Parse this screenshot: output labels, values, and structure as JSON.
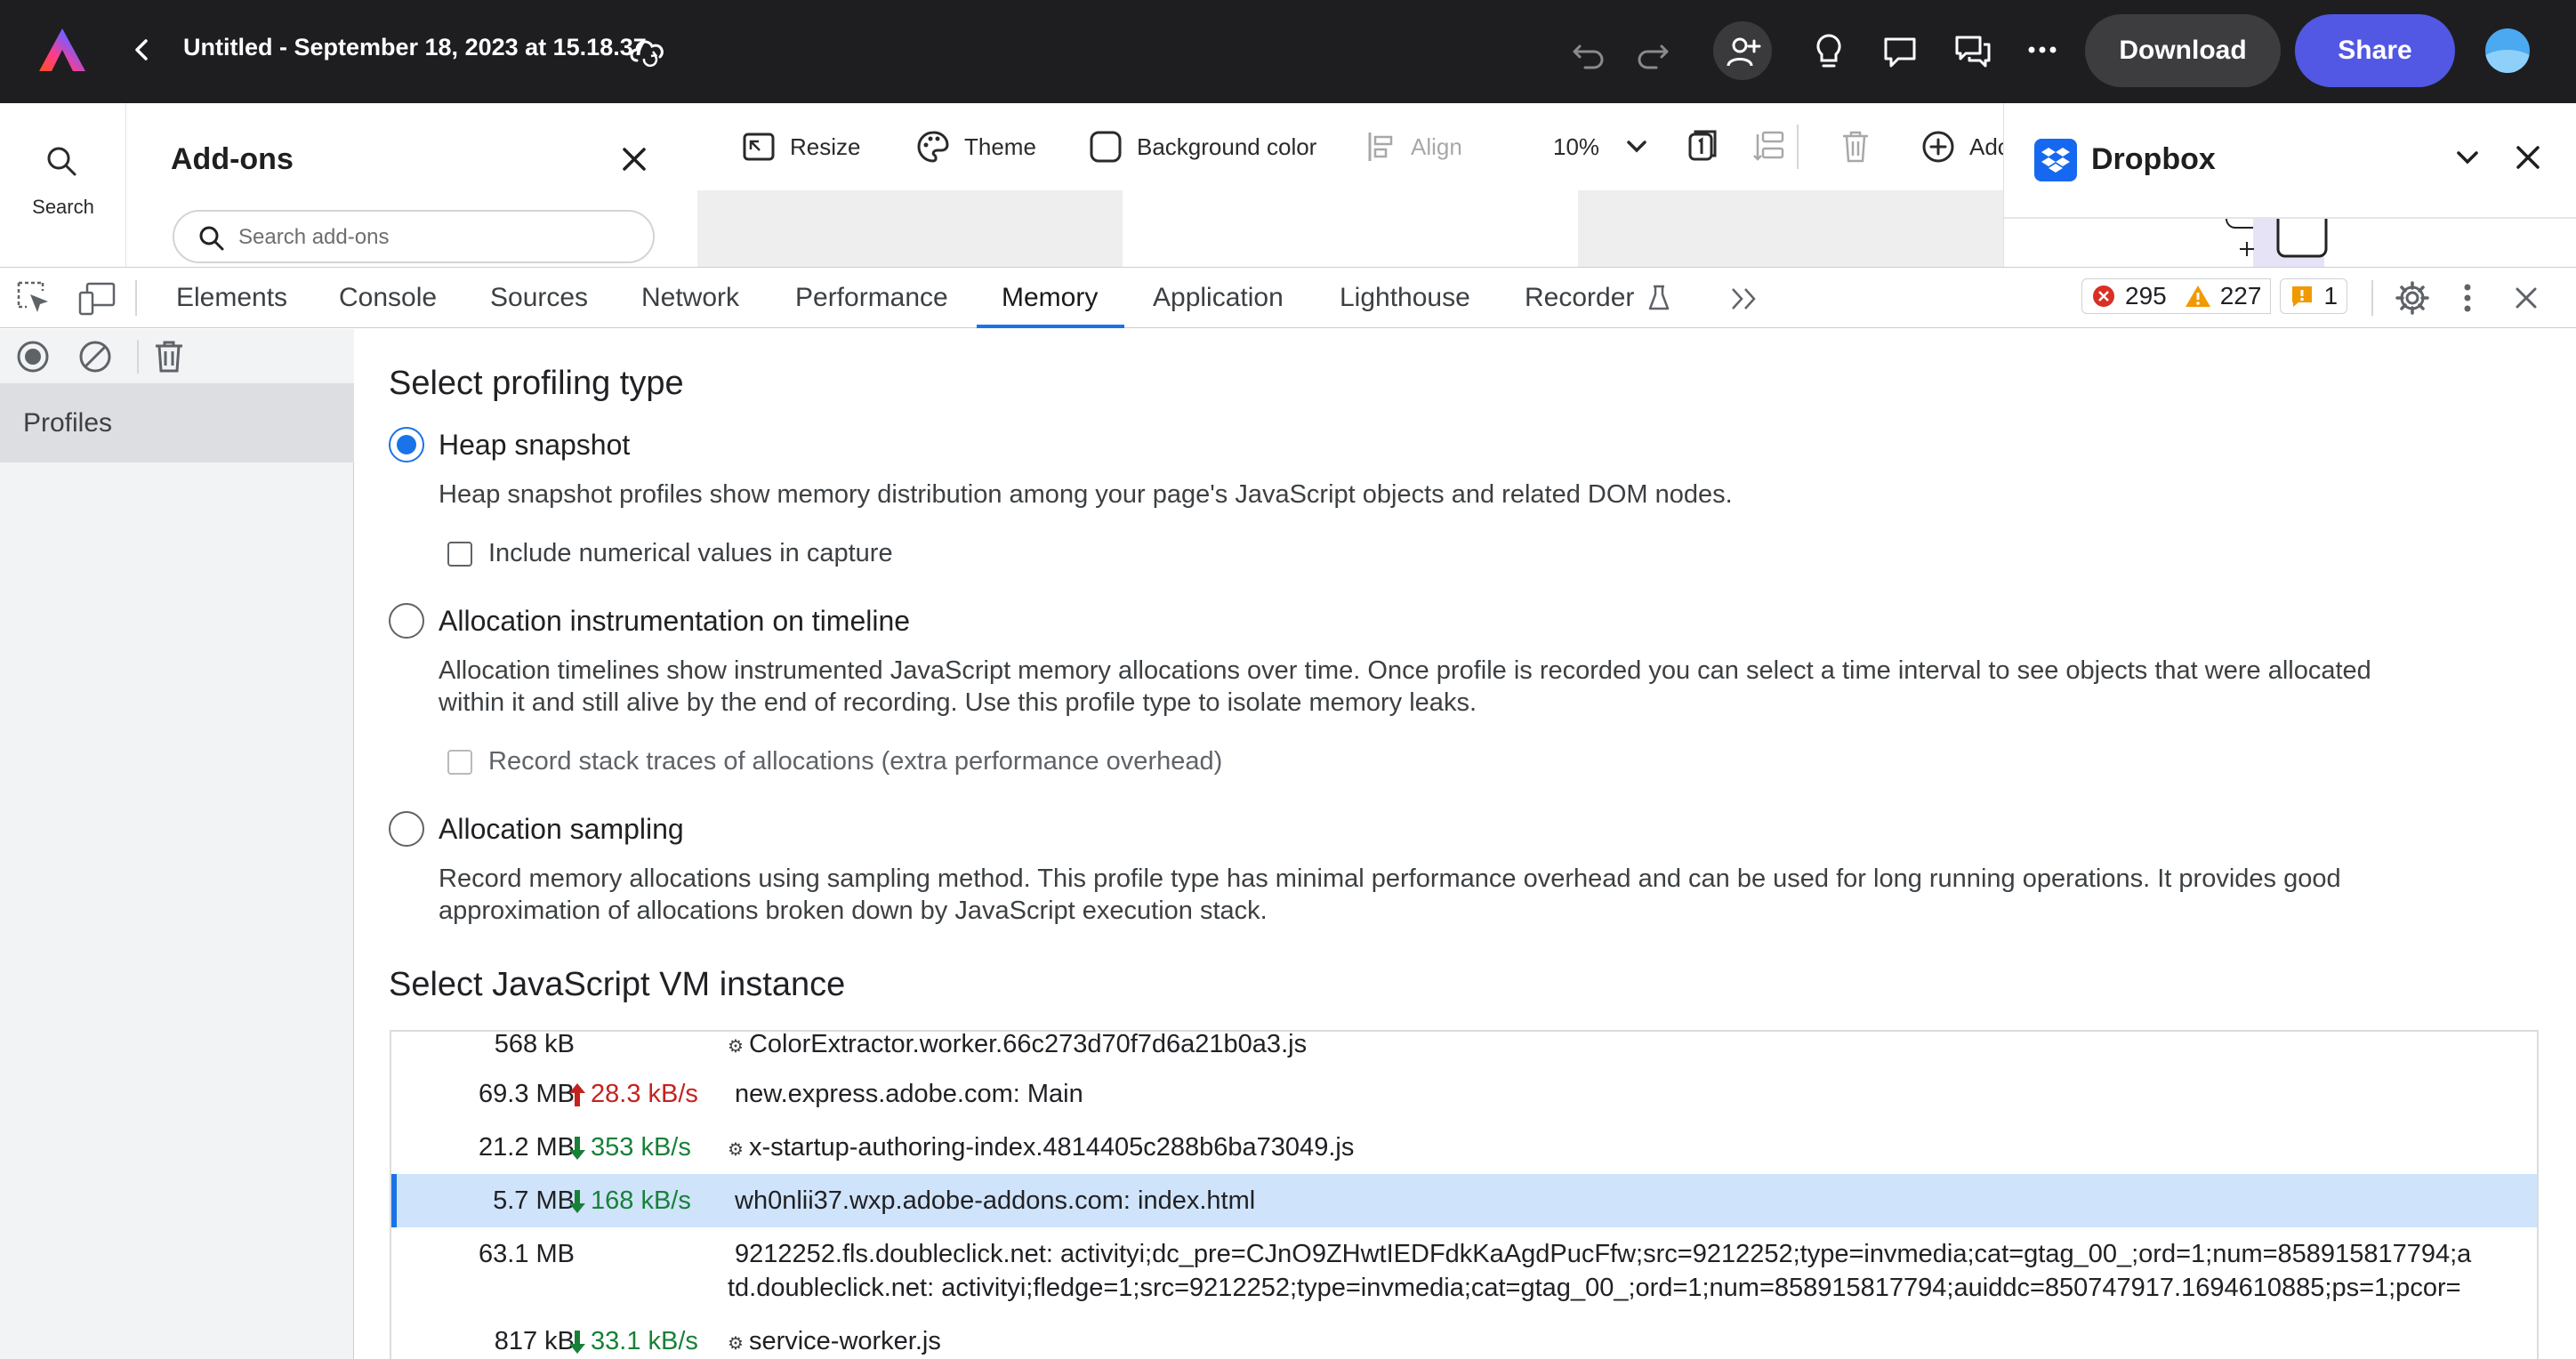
{
  "app": {
    "doc_title": "Untitled - September 18, 2023 at 15.18.37",
    "download_label": "Download",
    "share_label": "Share"
  },
  "rail": {
    "search_label": "Search"
  },
  "addons": {
    "title": "Add-ons",
    "search_placeholder": "Search add-ons"
  },
  "canvas_toolbar": {
    "resize": "Resize",
    "theme": "Theme",
    "background_color": "Background color",
    "align": "Align",
    "zoom": "10%",
    "add_partial": "Adc"
  },
  "dropbox": {
    "title": "Dropbox"
  },
  "devtools": {
    "tabs": [
      "Elements",
      "Console",
      "Sources",
      "Network",
      "Performance",
      "Memory",
      "Application",
      "Lighthouse",
      "Recorder"
    ],
    "active_tab": "Memory",
    "errors": "295",
    "warnings": "227",
    "issues": "1",
    "sidebar": {
      "profiles_label": "Profiles"
    },
    "profiling": {
      "heading": "Select profiling type",
      "heap_snapshot": {
        "label": "Heap snapshot",
        "description": "Heap snapshot profiles show memory distribution among your page's JavaScript objects and related DOM nodes.",
        "option": "Include numerical values in capture"
      },
      "allocation_timeline": {
        "label": "Allocation instrumentation on timeline",
        "description_1": "Allocation timelines show instrumented JavaScript memory allocations over time. Once profile is recorded you can select a time interval to see objects that were allocated",
        "description_2": "within it and still alive by the end of recording. Use this profile type to isolate memory leaks.",
        "option": "Record stack traces of allocations (extra performance overhead)"
      },
      "allocation_sampling": {
        "label": "Allocation sampling",
        "description_1": "Record memory allocations using sampling method. This profile type has minimal performance overhead and can be used for long running operations. It provides good",
        "description_2": "approximation of allocations broken down by JavaScript execution stack."
      }
    },
    "vm": {
      "heading": "Select JavaScript VM instance",
      "rows": [
        {
          "size": "568 kB",
          "rate": "",
          "dir": "",
          "name": "ColorExtractor.worker.66c273d70f7d6a21b0a3.js",
          "worker": true
        },
        {
          "size": "69.3 MB",
          "rate": "28.3 kB/s",
          "dir": "up",
          "name": "new.express.adobe.com: Main",
          "worker": false
        },
        {
          "size": "21.2 MB",
          "rate": "353 kB/s",
          "dir": "down",
          "name": "x-startup-authoring-index.4814405c288b6ba73049.js",
          "worker": true
        },
        {
          "size": "5.7 MB",
          "rate": "168 kB/s",
          "dir": "down",
          "name": "wh0nlii37.wxp.adobe-addons.com: index.html",
          "worker": false,
          "selected": true
        },
        {
          "size": "63.1 MB",
          "rate": "",
          "dir": "",
          "name": "9212252.fls.doubleclick.net: activityi;dc_pre=CJnO9ZHwtIEDFdkKaAgdPucFfw;src=9212252;type=invmedia;cat=gtag_00_;ord=1;num=858915817794;a",
          "name2": "td.doubleclick.net: activityi;fledge=1;src=9212252;type=invmedia;cat=gtag_00_;ord=1;num=858915817794;auiddc=850747917.1694610885;ps=1;pcor=",
          "worker": false
        },
        {
          "size": "817 kB",
          "rate": "33.1 kB/s",
          "dir": "down",
          "name": "service-worker.js",
          "worker": true
        }
      ]
    }
  }
}
